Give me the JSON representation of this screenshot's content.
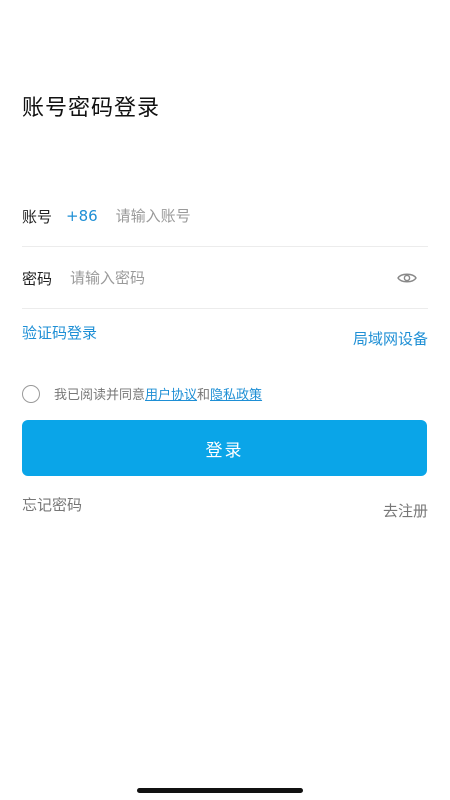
{
  "page": {
    "title": "账号密码登录"
  },
  "account": {
    "label": "账号",
    "country_code": "+86",
    "placeholder": "请输入账号",
    "value": ""
  },
  "password": {
    "label": "密码",
    "placeholder": "请输入密码",
    "value": "",
    "toggle_icon": "eye-icon"
  },
  "links": {
    "sms_login": "验证码登录",
    "lan_device": "局域网设备"
  },
  "agreement": {
    "prefix": "我已阅读并同意",
    "user_agreement": "用户协议",
    "conjunction": "和",
    "privacy_policy": "隐私政策",
    "checked": false
  },
  "login_button": {
    "label": "登录"
  },
  "bottom": {
    "forgot": "忘记密码",
    "register": "去注册"
  },
  "colors": {
    "accent": "#1e8fd5",
    "button": "#0aa5e8",
    "muted": "#777777"
  }
}
